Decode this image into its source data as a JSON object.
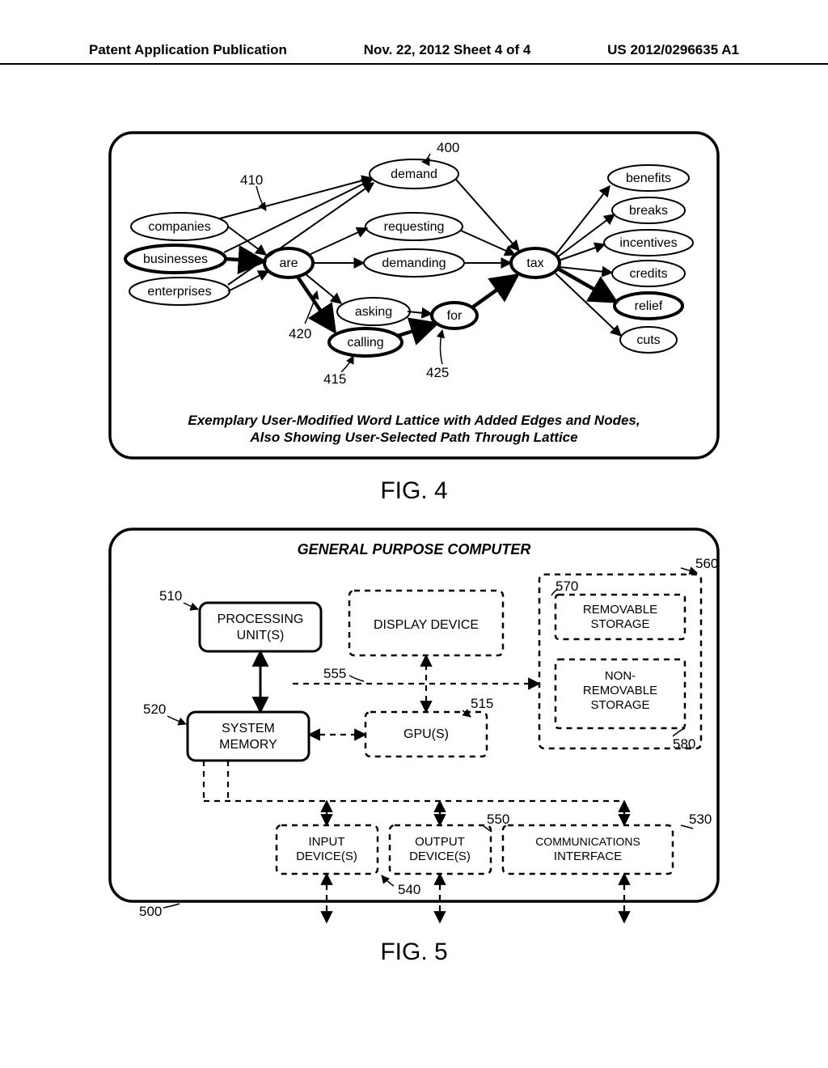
{
  "header": {
    "left": "Patent Application Publication",
    "center": "Nov. 22, 2012  Sheet 4 of 4",
    "right": "US 2012/0296635 A1"
  },
  "fig4": {
    "label": "FIG. 4",
    "caption1": "Exemplary User-Modified Word Lattice with Added Edges and Nodes,",
    "caption2": "Also Showing User-Selected Path Through Lattice",
    "refs": {
      "r400": "400",
      "r410": "410",
      "r415": "415",
      "r420": "420",
      "r425": "425"
    },
    "nodes": {
      "companies": "companies",
      "businesses": "businesses",
      "enterprises": "enterprises",
      "are": "are",
      "demand": "demand",
      "requesting": "requesting",
      "demanding": "demanding",
      "asking": "asking",
      "calling": "calling",
      "for": "for",
      "tax": "tax",
      "benefits": "benefits",
      "breaks": "breaks",
      "incentives": "incentives",
      "credits": "credits",
      "relief": "relief",
      "cuts": "cuts"
    }
  },
  "fig5": {
    "label": "FIG. 5",
    "title": "GENERAL PURPOSE COMPUTER",
    "refs": {
      "r500": "500",
      "r510": "510",
      "r515": "515",
      "r520": "520",
      "r530": "530",
      "r540": "540",
      "r550": "550",
      "r555": "555",
      "r560": "560",
      "r570": "570",
      "r580": "580"
    },
    "boxes": {
      "processing": "PROCESSING\nUNIT(S)",
      "memory": "SYSTEM\nMEMORY",
      "display": "DISPLAY DEVICE",
      "gpu": "GPU(S)",
      "input": "INPUT\nDEVICE(S)",
      "output": "OUTPUT\nDEVICE(S)",
      "comms": "COMMUNICATIONS\nINTERFACE",
      "removable": "REMOVABLE\nSTORAGE",
      "nonremovable": "NON-\nREMOVABLE\nSTORAGE"
    }
  }
}
